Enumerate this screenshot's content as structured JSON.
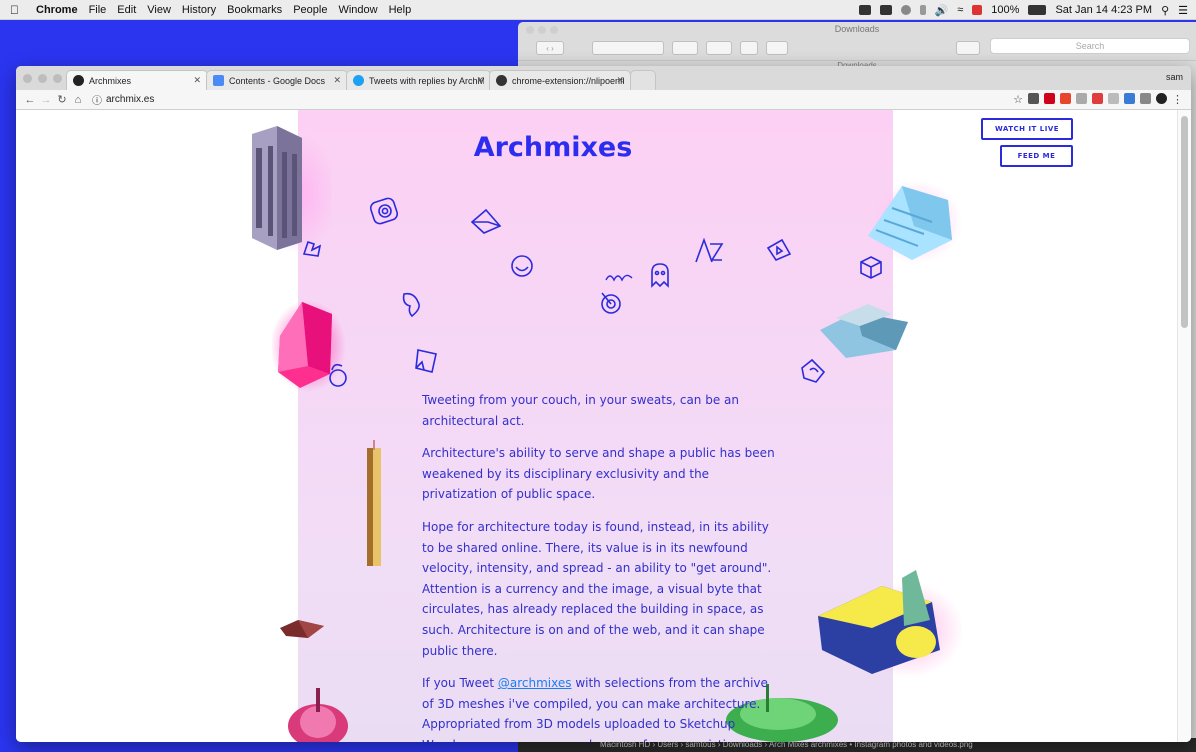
{
  "menubar": {
    "app": "Chrome",
    "menus": [
      "File",
      "Edit",
      "View",
      "History",
      "Bookmarks",
      "People",
      "Window",
      "Help"
    ],
    "battery": "100%",
    "clock": "Sat Jan 14  4:23 PM"
  },
  "finder": {
    "title": "Downloads",
    "search_placeholder": "Search",
    "path_label": "Downloads",
    "status_path": "Macintosh HD  ›  Users  ›  samtous  ›  Downloads  ›  Arch Mixes  archmixes • Instagram photos and videos.png"
  },
  "chrome": {
    "user": "sam",
    "tabs": [
      {
        "label": "Archmixes",
        "color": "#222222"
      },
      {
        "label": "Contents - Google Docs",
        "color": "#4a8af4"
      },
      {
        "label": "Tweets with replies by ArchMi",
        "color": "#1da1f2"
      },
      {
        "label": "chrome-extension://nlipoenfbl",
        "color": "#333333"
      }
    ],
    "url": "archmix.es",
    "extension_colors": [
      "#555555",
      "#d0021b",
      "#e8462c",
      "#aaaaaa",
      "#e03c3c",
      "#bbbbbb",
      "#3a7bd5",
      "#888888",
      "#222222"
    ]
  },
  "page": {
    "title": "Archmixes",
    "watch_label": "WATCH IT LIVE",
    "feed_label": "FEED ME",
    "p1": "Tweeting from your couch, in your sweats, can be an architectural act.",
    "p2": "Architecture's ability to serve and shape a public has been weakened by its disciplinary exclusivity and the privatization of public space.",
    "p3": "Hope for architecture today is found, instead, in its ability to be shared online. There, its value is in its newfound velocity, intensity, and spread - an ability to \"get around\". Attention is a currency and the image, a visual byte that circulates, has already replaced the building in space, as such. Architecture is on and of the web, and it can shape public there.",
    "p4_before": "If you Tweet ",
    "p4_mention": "@archmixes",
    "p4_after": " with selections from the archive of 3D meshes i've compiled, you can make architecture. Appropriated from 3D models uploaded to Sketchup Warehouse, anyone can make anew from preexisting",
    "accent": "#2d2df0"
  }
}
